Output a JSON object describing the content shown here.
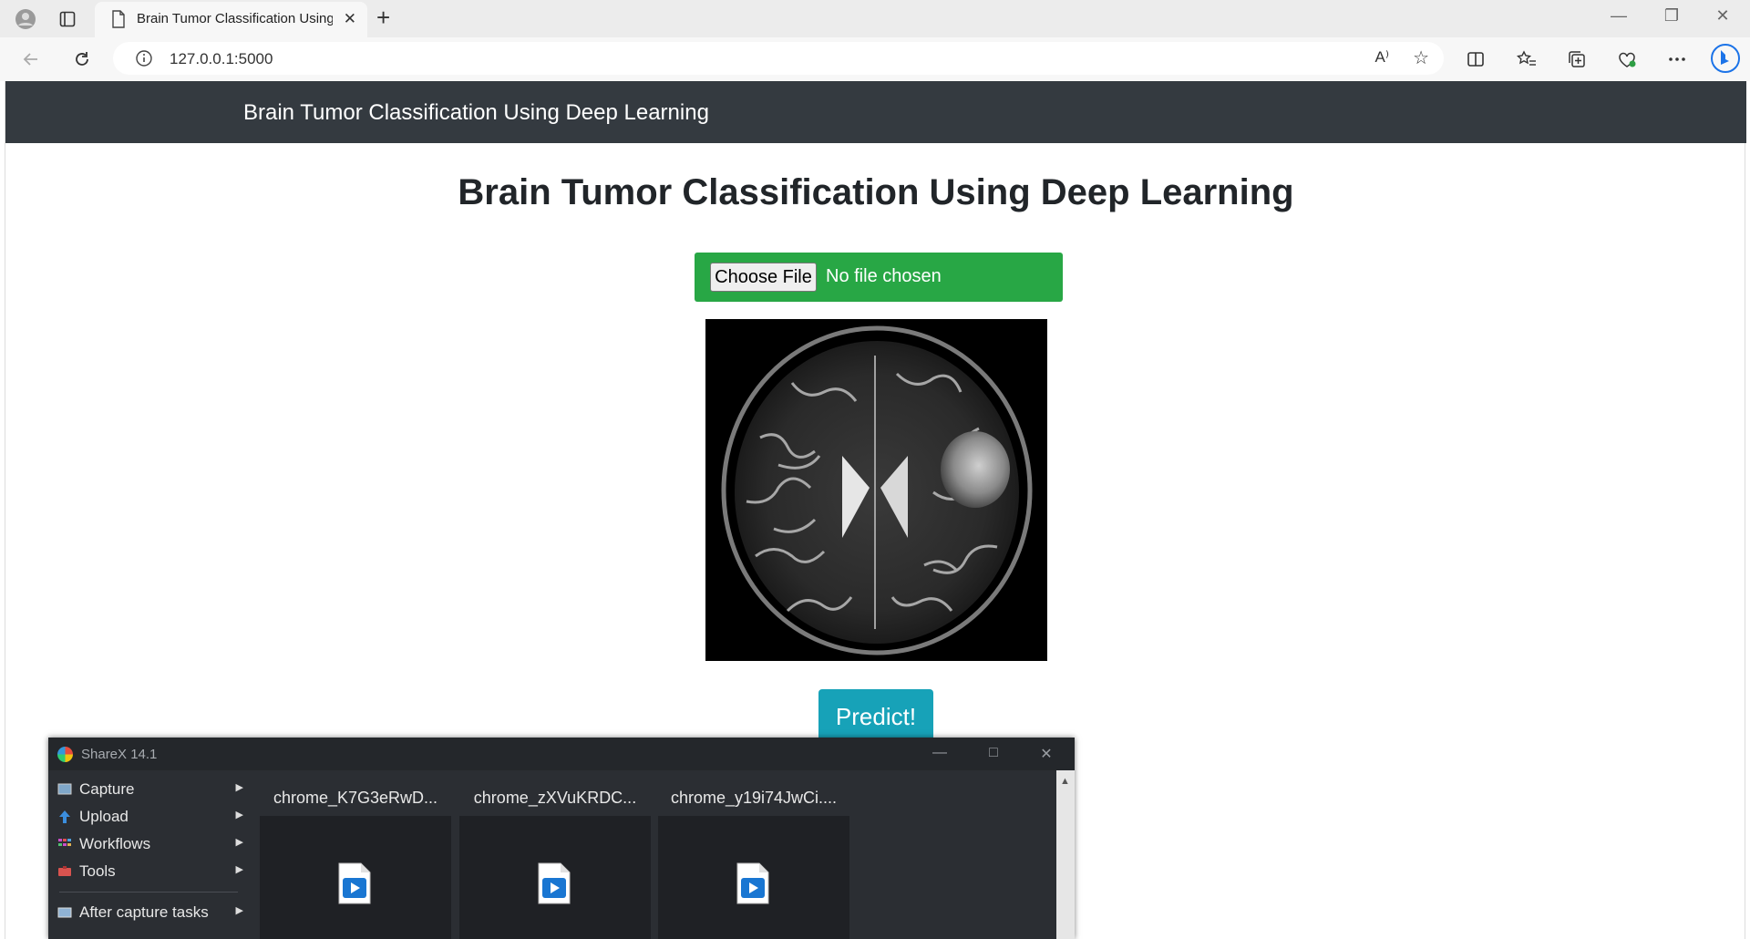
{
  "browser": {
    "tab_title": "Brain Tumor Classification Using Deep Learning",
    "tab_close": "✕",
    "new_tab": "+",
    "url": "127.0.0.1:5000"
  },
  "navbar": {
    "brand": "Brain Tumor Classification Using Deep Learning"
  },
  "main": {
    "heading": "Brain Tumor Classification Using Deep Learning",
    "file_button": "Choose File",
    "file_status": "No file chosen",
    "predict_button": "Predict!"
  },
  "sharex": {
    "title": "ShareX 14.1",
    "menu": [
      {
        "label": "Capture",
        "icon": "capture-icon"
      },
      {
        "label": "Upload",
        "icon": "upload-icon"
      },
      {
        "label": "Workflows",
        "icon": "workflows-icon"
      },
      {
        "label": "Tools",
        "icon": "tools-icon"
      },
      {
        "label": "After capture tasks",
        "icon": "after-capture-icon"
      }
    ],
    "files": [
      {
        "name": "chrome_K7G3eRwD..."
      },
      {
        "name": "chrome_zXVuKRDC..."
      },
      {
        "name": "chrome_y19i74JwCi...."
      }
    ]
  },
  "colors": {
    "navbar": "#343a40",
    "file_form": "#28a745",
    "predict": "#17a2b8"
  }
}
